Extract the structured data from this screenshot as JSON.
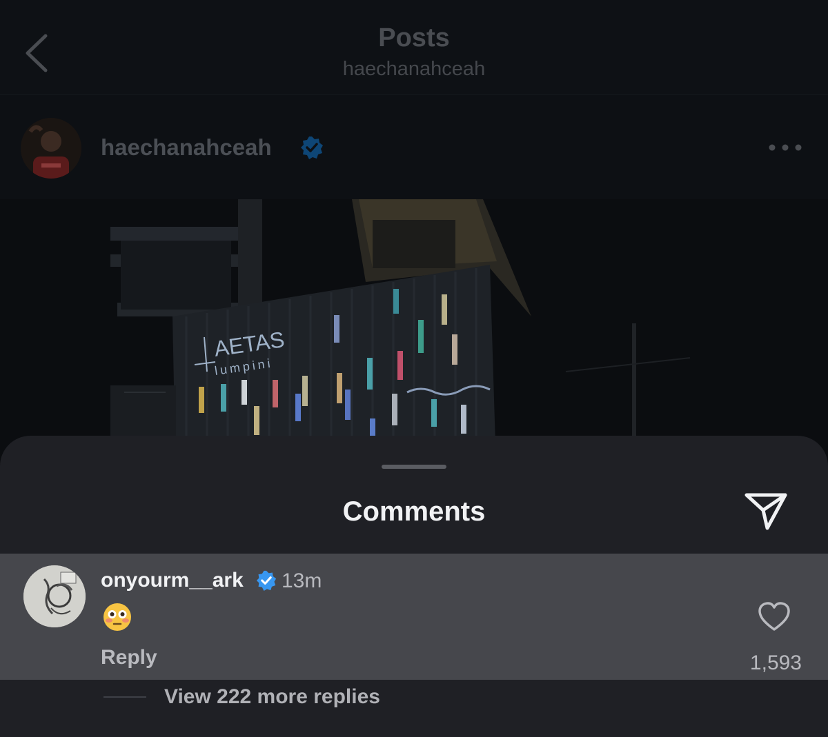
{
  "header": {
    "title": "Posts",
    "subtitle": "haechanahceah"
  },
  "post": {
    "username": "haechanahceah",
    "verified": true,
    "image_text": {
      "brand": "AETAS",
      "sub": "lumpini"
    }
  },
  "comments_sheet": {
    "title": "Comments",
    "comment": {
      "username": "onyourm__ark",
      "verified": true,
      "time": "13m",
      "emoji": "flushed-face",
      "reply_label": "Reply",
      "likes": "1,593"
    },
    "view_replies": "View 222 more replies"
  },
  "colors": {
    "background": "#0d1014",
    "sheet": "#1f2025",
    "highlight_row": "#46474c",
    "verified_blue": "#3897f0"
  },
  "icons": [
    "back-chevron-icon",
    "verified-badge-icon",
    "more-options-icon",
    "share-send-icon",
    "heart-icon"
  ]
}
